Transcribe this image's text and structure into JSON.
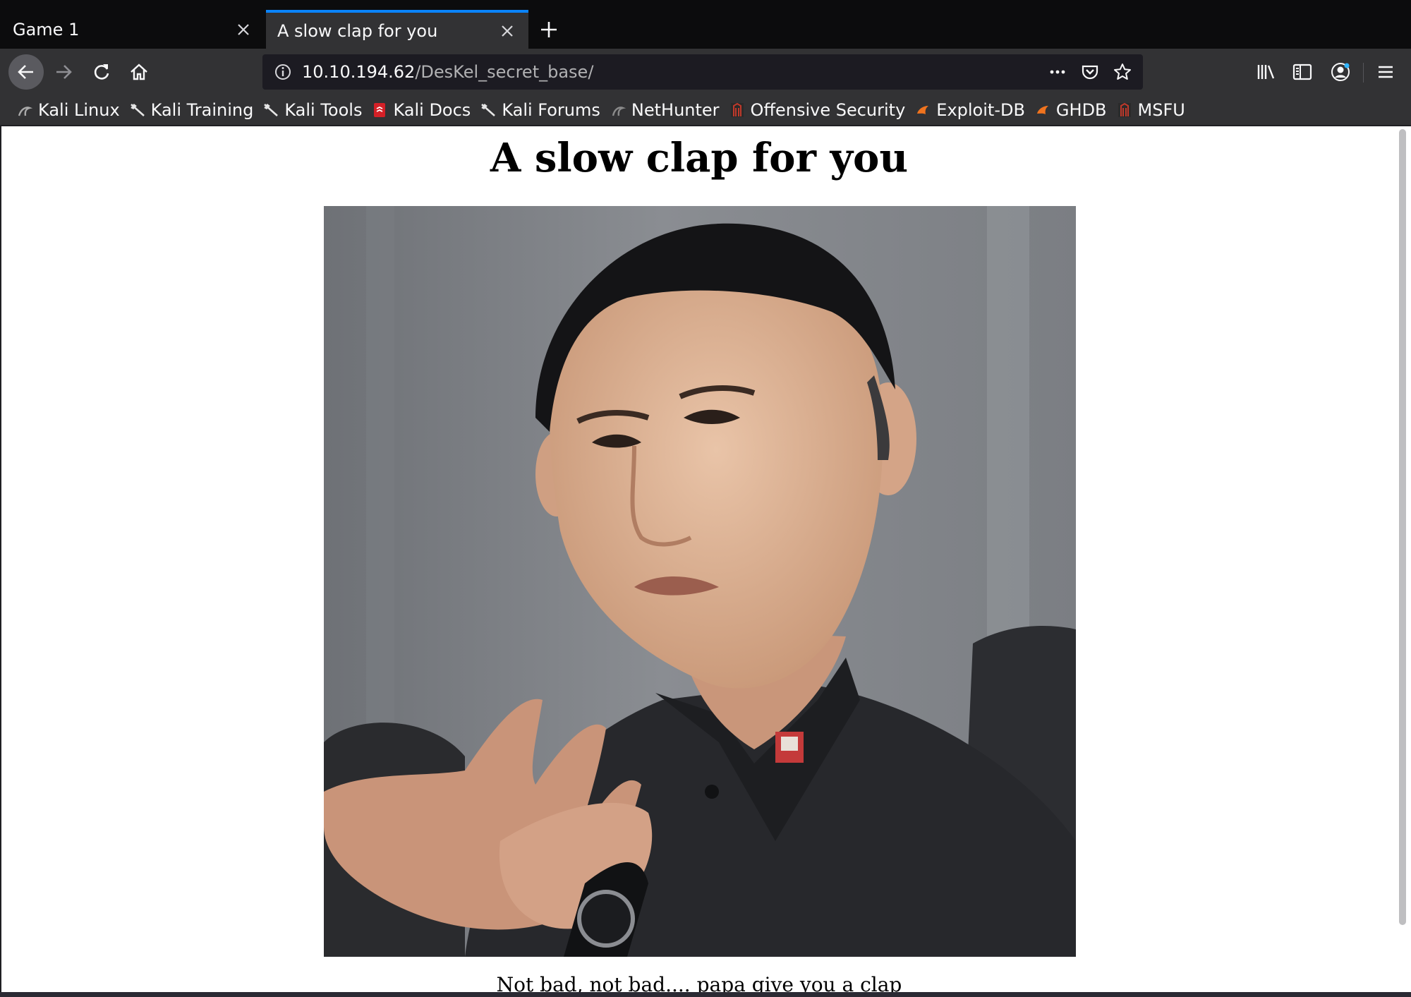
{
  "tabs": [
    {
      "title": "Game 1",
      "active": false
    },
    {
      "title": "A slow clap for you",
      "active": true
    }
  ],
  "address_bar": {
    "host": "10.10.194.62",
    "path": "/DesKel_secret_base/"
  },
  "bookmarks": [
    {
      "label": "Kali Linux",
      "icon": "kali-dragon-icon"
    },
    {
      "label": "Kali Training",
      "icon": "kali-dragon-icon"
    },
    {
      "label": "Kali Tools",
      "icon": "kali-dragon-icon"
    },
    {
      "label": "Kali Docs",
      "icon": "kali-docs-icon"
    },
    {
      "label": "Kali Forums",
      "icon": "kali-dragon-icon"
    },
    {
      "label": "NetHunter",
      "icon": "nethunter-icon"
    },
    {
      "label": "Offensive Security",
      "icon": "offsec-icon"
    },
    {
      "label": "Exploit-DB",
      "icon": "exploit-db-icon"
    },
    {
      "label": "GHDB",
      "icon": "exploit-db-icon"
    },
    {
      "label": "MSFU",
      "icon": "offsec-icon"
    }
  ],
  "page": {
    "heading": "A slow clap for you",
    "caption": "Not bad, not bad.... papa give you a clap"
  },
  "colors": {
    "tab_accent": "#0a84ff",
    "toolbar": "#323234",
    "tabstrip": "#0c0c0d"
  }
}
